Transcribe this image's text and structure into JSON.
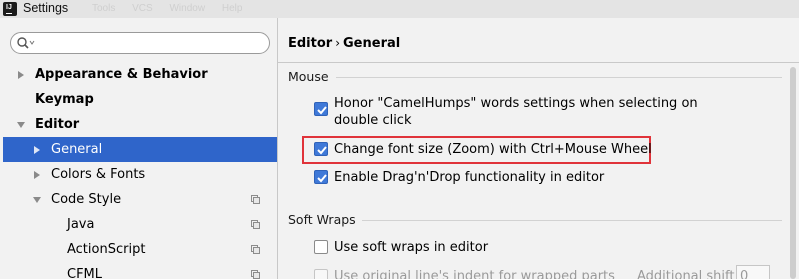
{
  "window": {
    "icon_text": "IJ",
    "title": "Settings",
    "ghost_menu": [
      "Tools",
      "VCS",
      "Window",
      "Help"
    ]
  },
  "search": {
    "value": "",
    "placeholder": ""
  },
  "tree": {
    "items": [
      {
        "label": "Appearance & Behavior",
        "expanded": false,
        "bold": true
      },
      {
        "label": "Keymap",
        "bold": true
      },
      {
        "label": "Editor",
        "expanded": true,
        "bold": true
      },
      {
        "label": "General",
        "expanded": false,
        "selected": true
      },
      {
        "label": "Colors & Fonts",
        "expanded": false
      },
      {
        "label": "Code Style",
        "expanded": true,
        "copy_icon": "copy-icon"
      },
      {
        "label": "Java",
        "copy_icon": "copy-icon"
      },
      {
        "label": "ActionScript",
        "copy_icon": "copy-icon"
      },
      {
        "label": "CFML",
        "copy_icon": "copy-icon"
      }
    ]
  },
  "breadcrumb": {
    "parent": "Editor",
    "separator": "›",
    "current": "General"
  },
  "sections": {
    "mouse": {
      "title": "Mouse",
      "options": [
        {
          "line1": "Honor \"CamelHumps\" words settings when selecting on",
          "line2": "double click",
          "checked": true
        },
        {
          "label": "Change font size (Zoom) with Ctrl+Mouse Wheel",
          "checked": true,
          "highlighted": true
        },
        {
          "label": "Enable Drag'n'Drop functionality in editor",
          "checked": true
        }
      ]
    },
    "soft_wraps": {
      "title": "Soft Wraps",
      "options": [
        {
          "label": "Use soft wraps in editor",
          "checked": false
        },
        {
          "label": "Use original line's indent for wrapped parts",
          "checked": false,
          "disabled": true
        }
      ],
      "additional_shift_label": "Additional shift:",
      "additional_shift_value": "0"
    }
  },
  "colors": {
    "selection": "#2f65ca",
    "checkbox_on": "#3f79d8",
    "highlight_border": "#e0333a"
  }
}
